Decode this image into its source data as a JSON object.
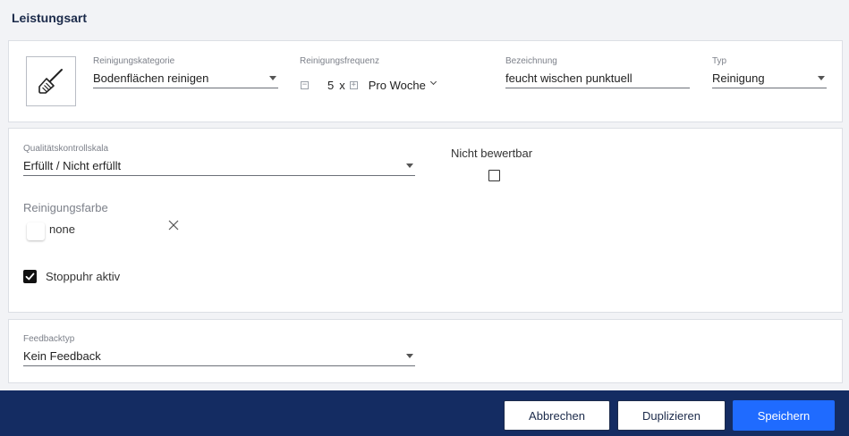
{
  "page": {
    "title": "Leistungsart"
  },
  "service": {
    "icon": "broom-icon",
    "category_label": "Reinigungskategorie",
    "category_value": "Bodenflächen reinigen",
    "frequency_label": "Reinigungsfrequenz",
    "frequency_count": "5",
    "frequency_times": "x",
    "frequency_period": "Pro Woche",
    "name_label": "Bezeichnung",
    "name_value": "feucht wischen punktuell",
    "type_label": "Typ",
    "type_value": "Reinigung"
  },
  "quality": {
    "scale_label": "Qualitätskontrollskala",
    "scale_value": "Erfüllt / Nicht erfüllt",
    "not_ratable_label": "Nicht bewertbar",
    "not_ratable_checked": false,
    "color_label": "Reinigungsfarbe",
    "color_value": "none",
    "stopwatch_label": "Stoppuhr aktiv",
    "stopwatch_checked": true
  },
  "feedback": {
    "type_label": "Feedbacktyp",
    "type_value": "Kein Feedback"
  },
  "footer": {
    "cancel_label": "Abbrechen",
    "duplicate_label": "Duplizieren",
    "save_label": "Speichern"
  },
  "colors": {
    "header_bg": "#142c62",
    "primary": "#1f6bff",
    "page_bg": "#f2f3f6"
  }
}
